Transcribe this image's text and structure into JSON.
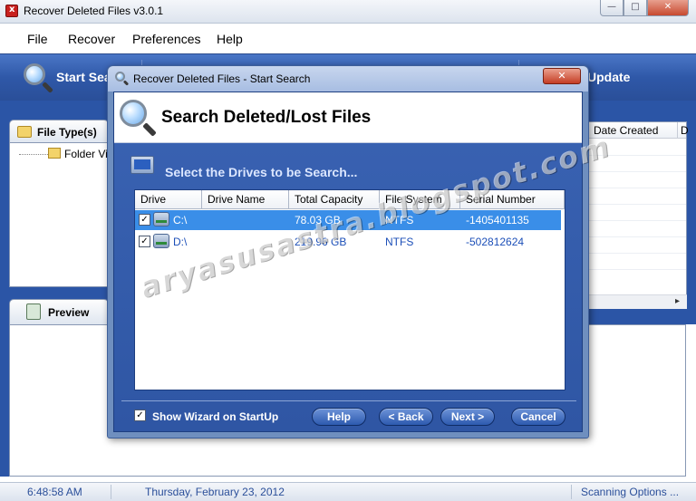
{
  "window": {
    "title": "Recover Deleted Files v3.0.1",
    "controls": {
      "minimize": "—",
      "maximize": "□",
      "close": "✕"
    }
  },
  "menu": {
    "file": "File",
    "recover": "Recover",
    "preferences": "Preferences",
    "help": "Help"
  },
  "toolbar": {
    "start_search": "Start Sea",
    "update": "Update"
  },
  "left": {
    "file_types_tab": "File Type(s)",
    "folder_view": "Folder Vie",
    "preview_tab": "Preview"
  },
  "right_list": {
    "col_date_created": "Date Created",
    "col_next": "D",
    "scroll_arrow": "▸"
  },
  "status": {
    "time": "6:48:58 AM",
    "date": "Thursday, February 23, 2012",
    "scanning": "Scanning Options ..."
  },
  "dialog": {
    "title": "Recover Deleted Files - Start Search",
    "close": "✕",
    "heading": "Search Deleted/Lost Files",
    "subheading": "Select the Drives to be Search...",
    "columns": {
      "drive": "Drive",
      "drive_name": "Drive Name",
      "total_capacity": "Total Capacity",
      "file_system": "File System",
      "serial_number": "Serial Number"
    },
    "drives": [
      {
        "check": "✓",
        "drive": "C:\\",
        "name": "",
        "capacity": "78.03 GB",
        "fs": "NTFS",
        "serial": "-1405401135"
      },
      {
        "check": "✓",
        "drive": "D:\\",
        "name": "",
        "capacity": "219.96 GB",
        "fs": "NTFS",
        "serial": "-502812624"
      }
    ],
    "show_wizard_check": "✓",
    "show_wizard": "Show Wizard on StartUp",
    "buttons": {
      "help": "Help",
      "back": "< Back",
      "next": "Next >",
      "cancel": "Cancel"
    }
  },
  "watermark": "aryasusastra.blogspot.com",
  "colors": {
    "toolbar_blue": "#2f58a8",
    "selection_blue": "#3a8ee8",
    "status_text": "#2b4f9a"
  }
}
